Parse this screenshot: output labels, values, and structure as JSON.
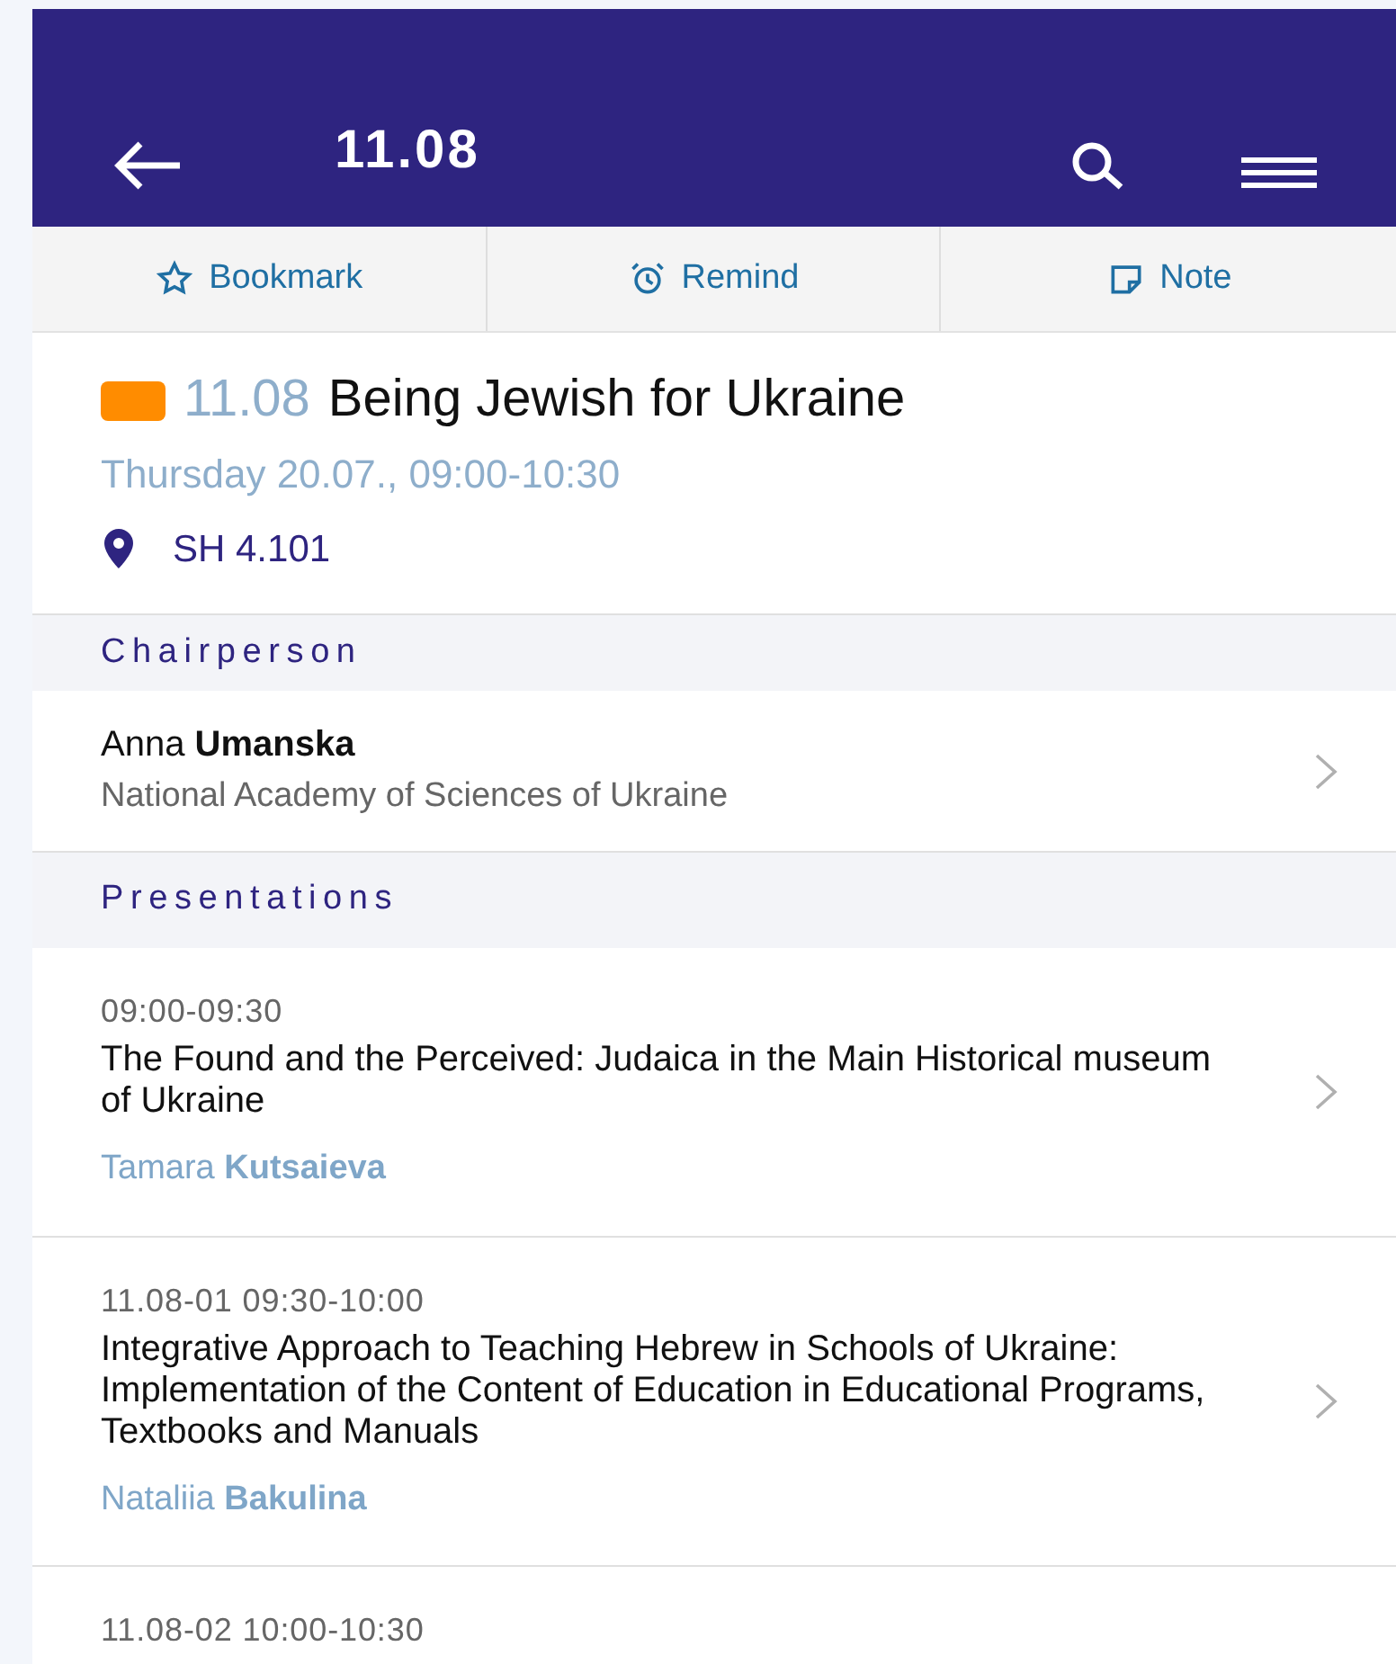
{
  "app_bar": {
    "title": "11.08"
  },
  "actions": [
    {
      "kind": "bookmark",
      "label": "Bookmark"
    },
    {
      "kind": "remind",
      "label": "Remind"
    },
    {
      "kind": "note",
      "label": "Note"
    }
  ],
  "session": {
    "color": "#ff8c00",
    "code": "11.08",
    "title": "Being Jewish for Ukraine",
    "datetime": "Thursday 20.07., 09:00-10:30",
    "location": "SH 4.101"
  },
  "chairperson": {
    "heading": "Chairperson",
    "name": "Anna **Umanska**",
    "affiliation": "National Academy of Sciences of Ukraine"
  },
  "presentations": {
    "heading": "Presentations",
    "items": [
      {
        "time": "09:00-09:30",
        "title": "The Found and the Perceived: Judaica in the Main Historical museum of Ukraine",
        "speaker": "Tamara **Kutsaieva**"
      },
      {
        "time": "11.08-01 09:30-10:00",
        "title": "Integrative Approach to Teaching Hebrew in Schools of Ukraine: Implementation of the Content of Education in Educational Programs, Textbooks and Manuals",
        "speaker": "Nataliia **Bakulina**"
      },
      {
        "time": "11.08-02 10:00-10:30"
      }
    ]
  }
}
